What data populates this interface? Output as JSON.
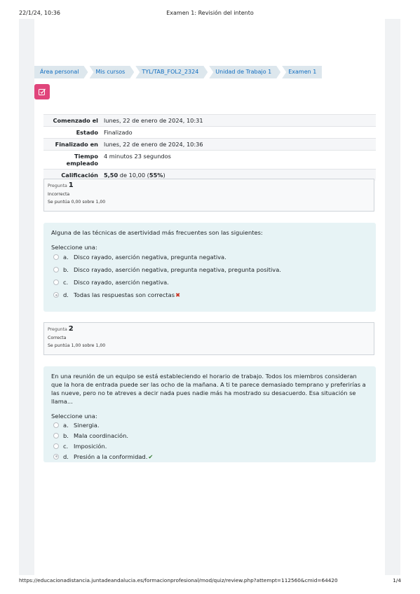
{
  "print_header": {
    "datetime": "22/1/24, 10:36",
    "title": "Examen 1: Revisión del intento"
  },
  "print_footer": {
    "url": "https://educacionadistancia.juntadeandalucia.es/formacionprofesional/mod/quiz/review.php?attempt=112560&cmid=64420",
    "page": "1/4"
  },
  "breadcrumb": [
    "Área personal",
    "Mis cursos",
    "TYL/TAB_FOL2_2324",
    "Unidad de Trabajo 1",
    "Examen 1"
  ],
  "summary": [
    {
      "label": "Comenzado el",
      "value": "lunes, 22 de enero de 2024, 10:31"
    },
    {
      "label": "Estado",
      "value": "Finalizado"
    },
    {
      "label": "Finalizado en",
      "value": "lunes, 22 de enero de 2024, 10:36"
    },
    {
      "label": "Tiempo empleado",
      "value": "4 minutos 23 segundos"
    },
    {
      "label": "Calificación",
      "value_bold": "5,50",
      "value_mid": " de 10,00 (",
      "value_pct": "55%",
      "value_end": ")"
    }
  ],
  "questions": [
    {
      "label": "Pregunta",
      "number": "1",
      "state": "Incorrecta",
      "marks": "Se puntúa 0,00 sobre 1,00",
      "text": "Alguna de las técnicas de asertividad más frecuentes son las siguientes:",
      "prompt": "Seleccione una:",
      "options": [
        {
          "letter": "a.",
          "text": "Disco rayado, aserción negativa, pregunta negativa."
        },
        {
          "letter": "b.",
          "text": "Disco rayado, aserción negativa, pregunta negativa, pregunta positiva."
        },
        {
          "letter": "c.",
          "text": "Disco rayado, aserción negativa."
        },
        {
          "letter": "d.",
          "text": "Todas las respuestas son correctas",
          "mark": "✖"
        }
      ]
    },
    {
      "label": "Pregunta",
      "number": "2",
      "state": "Correcta",
      "marks": "Se puntúa 1,00 sobre 1,00",
      "text": "En una reunión de un equipo se está estableciendo el horario de trabajo. Todos los miembros consideran que la hora de entrada puede ser las ocho de la mañana. A ti te parece demasiado temprano y preferirías a las nueve, pero no te atreves a decir nada pues nadie más ha mostrado su desacuerdo. Esa situación se llama...",
      "prompt": "Seleccione una:",
      "options": [
        {
          "letter": "a.",
          "text": "Sinergia."
        },
        {
          "letter": "b.",
          "text": "Mala coordinación."
        },
        {
          "letter": "c.",
          "text": "Imposición."
        },
        {
          "letter": "d.",
          "text": "Presión a la conformidad.",
          "mark": "✔"
        }
      ]
    }
  ],
  "colors": {
    "accent": "#0f6cbf",
    "quiz_icon": "#e0457b",
    "question_bg": "#e7f3f5",
    "incorrect": "#ca3120",
    "correct": "#357a32"
  }
}
